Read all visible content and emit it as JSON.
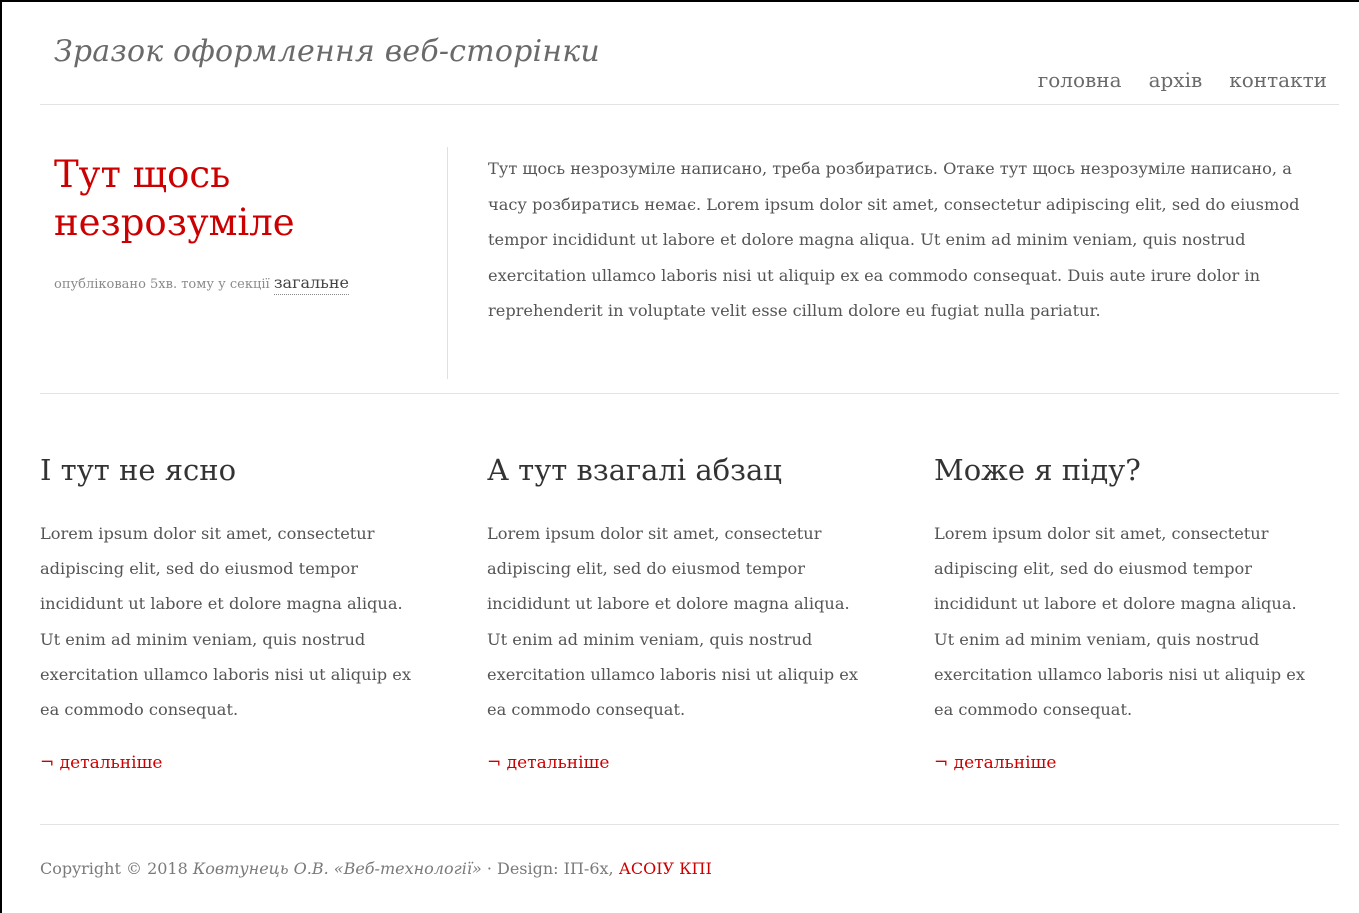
{
  "header": {
    "site_title": "Зразок оформлення веб-сторінки",
    "nav": [
      {
        "label": "головна"
      },
      {
        "label": "архів"
      },
      {
        "label": "контакти"
      }
    ]
  },
  "intro": {
    "title": "Тут щось незрозуміле",
    "meta_prefix": "опубліковано 5хв. тому у секції",
    "meta_section": "загальне",
    "text": "Тут щось незрозуміле написано, треба розбиратись. Отаке тут щось незрозуміле написано, а часу розбиратись немає. Lorem ipsum dolor sit amet, consectetur adipiscing elit, sed do eiusmod tempor incididunt ut labore et dolore magna aliqua. Ut enim ad minim veniam, quis nostrud exercitation ullamco laboris nisi ut aliquip ex ea commodo consequat. Duis aute irure dolor in reprehenderit in voluptate velit esse cillum dolore eu fugiat nulla pariatur."
  },
  "columns": [
    {
      "heading": "І тут не ясно",
      "text": "Lorem ipsum dolor sit amet, consectetur adipiscing elit, sed do eiusmod tempor incididunt ut labore et dolore magna aliqua. Ut enim ad minim veniam, quis nostrud exercitation ullamco laboris nisi ut aliquip ex ea commodo consequat.",
      "more_arrow": "¬",
      "more_label": "детальніше"
    },
    {
      "heading": "А тут взагалі абзац",
      "text": "Lorem ipsum dolor sit amet, consectetur adipiscing elit, sed do eiusmod tempor incididunt ut labore et dolore magna aliqua. Ut enim ad minim veniam, quis nostrud exercitation ullamco laboris nisi ut aliquip ex ea commodo consequat.",
      "more_arrow": "¬",
      "more_label": "детальніше"
    },
    {
      "heading": "Може я піду?",
      "text": "Lorem ipsum dolor sit amet, consectetur adipiscing elit, sed do eiusmod tempor incididunt ut labore et dolore magna aliqua. Ut enim ad minim veniam, quis nostrud exercitation ullamco laboris nisi ut aliquip ex ea commodo consequat.",
      "more_arrow": "¬",
      "more_label": "детальніше"
    }
  ],
  "footer": {
    "copyright": "Copyright © 2018",
    "author": "Ковтунець О.В. «Веб-технології»",
    "design": "· Design: ІП-6х,",
    "org": "АСОІУ КПІ"
  },
  "colors": {
    "accent": "#cc0000",
    "text": "#555555",
    "divider": "#e3e3e3"
  }
}
